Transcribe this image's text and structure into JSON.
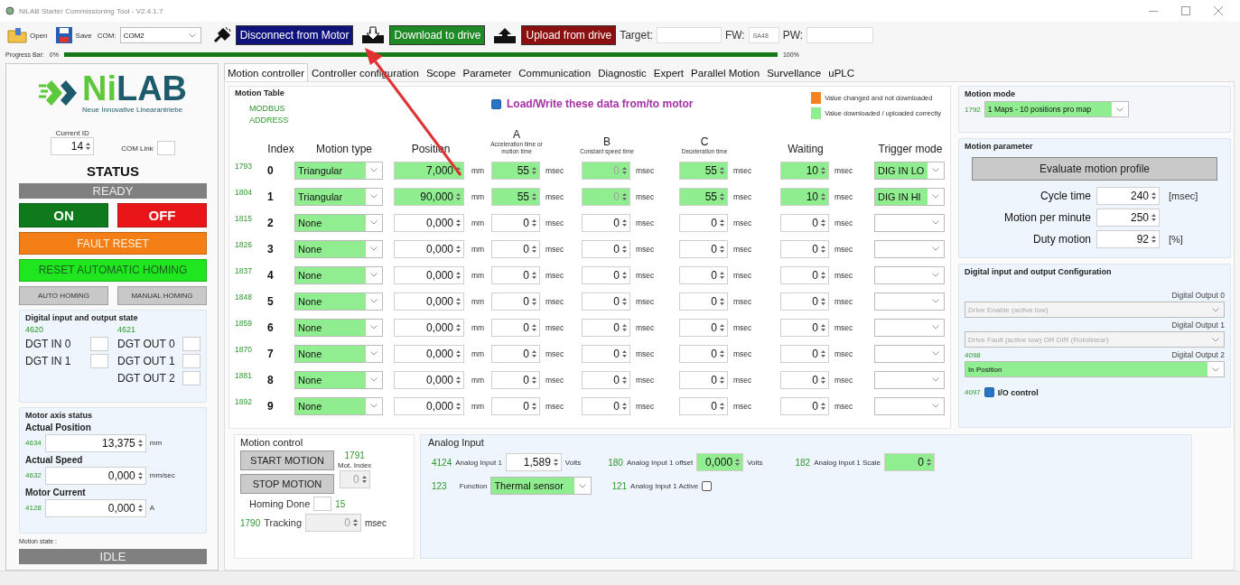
{
  "window": {
    "title": "NiLAB Starter Commissioning Tool - V2.4.1.7"
  },
  "toolbar": {
    "open": "Open",
    "save": "Save",
    "com_label": "COM:",
    "com_value": "COM2",
    "disconnect": "Disconnect from Motor",
    "download": "Download to drive",
    "upload": "Upload from drive",
    "target_label": "Target:",
    "fw_label": "FW:",
    "fw_value": "SA48",
    "pw_label": "PW:"
  },
  "progress": {
    "label": "Progress Bar:",
    "start": "0%",
    "end": "100%",
    "level": 1
  },
  "left": {
    "logo": {
      "name": "NiLAB",
      "tagline": "Neue Innovative Linearantriebe"
    },
    "current_id_label": "Current ID",
    "current_id": "14",
    "com_link_label": "COM Link",
    "com_link_on": false,
    "status_title": "STATUS",
    "status": "READY",
    "on": "ON",
    "off": "OFF",
    "fault_reset": "FAULT RESET",
    "reset_homing": "RESET AUTOMATIC HOMING",
    "auto_homing": "AUTO HOMING",
    "manual_homing": "MANUAL HOMING",
    "dio": {
      "title": "Digital input and output state",
      "inputs_address": "4620",
      "outputs_address": "4621",
      "inputs": [
        {
          "label": "DGT IN 0",
          "on": false
        },
        {
          "label": "DGT IN 1",
          "on": false
        }
      ],
      "outputs": [
        {
          "label": "DGT OUT 0",
          "on": false
        },
        {
          "label": "DGT OUT 1",
          "on": false
        },
        {
          "label": "DGT OUT 2",
          "on": false
        }
      ]
    },
    "axis": {
      "title": "Motor axis status",
      "items": [
        {
          "label": "Actual Position",
          "address": "4634",
          "value": "13,375",
          "unit": "mm"
        },
        {
          "label": "Actual Speed",
          "address": "4632",
          "value": "0,000",
          "unit": "mm/sec"
        },
        {
          "label": "Motor Current",
          "address": "4128",
          "value": "0,000",
          "unit": "A"
        }
      ]
    },
    "motion_state_label": "Motion state :",
    "motion_state": "IDLE"
  },
  "tabs": [
    {
      "label": "Motion controller",
      "selected": true
    },
    {
      "label": "Controller configuration",
      "selected": false
    },
    {
      "label": "Scope",
      "selected": false
    },
    {
      "label": "Parameter",
      "selected": false
    },
    {
      "label": "Communication",
      "selected": false
    },
    {
      "label": "Diagnostic",
      "selected": false
    },
    {
      "label": "Expert",
      "selected": false
    },
    {
      "label": "Parallel Motion",
      "selected": false
    },
    {
      "label": "Survellance",
      "selected": false
    },
    {
      "label": "uPLC",
      "selected": false
    }
  ],
  "motion_table": {
    "title": "Motion Table",
    "modbus_label": "MODBUS ADDRESS",
    "load_write": {
      "label": "Load/Write these data from/to motor",
      "checked": true
    },
    "legend": [
      {
        "label": "Value changed and not downloaded",
        "color": "#f58220"
      },
      {
        "label": "Value downloaded / uploaded correctly",
        "color": "#90ee90"
      }
    ],
    "columns": [
      {
        "label": "Index"
      },
      {
        "label": "Motion type"
      },
      {
        "label": "Position"
      },
      {
        "letter": "A",
        "label": "Acceleration time or motion time"
      },
      {
        "letter": "B",
        "label": "Constant speed time"
      },
      {
        "letter": "C",
        "label": "Deceleration time"
      },
      {
        "label": "Waiting"
      },
      {
        "label": "Trigger mode"
      }
    ],
    "rows": [
      {
        "address": "1793",
        "index": "0",
        "motion_type": "Triangular",
        "synced": true,
        "trigger": "DIG IN LO",
        "values": [
          {
            "value": "7,000",
            "unit": "mm",
            "disabled": false
          },
          {
            "value": "55",
            "unit": "msec",
            "disabled": false
          },
          {
            "value": "0",
            "unit": "msec",
            "disabled": true
          },
          {
            "value": "55",
            "unit": "msec",
            "disabled": false
          },
          {
            "value": "10",
            "unit": "msec",
            "disabled": false
          }
        ]
      },
      {
        "address": "1804",
        "index": "1",
        "motion_type": "Triangular",
        "synced": true,
        "trigger": "DIG IN HI",
        "values": [
          {
            "value": "90,000",
            "unit": "mm",
            "disabled": false
          },
          {
            "value": "55",
            "unit": "msec",
            "disabled": false
          },
          {
            "value": "0",
            "unit": "msec",
            "disabled": true
          },
          {
            "value": "55",
            "unit": "msec",
            "disabled": false
          },
          {
            "value": "10",
            "unit": "msec",
            "disabled": false
          }
        ]
      },
      {
        "address": "1815",
        "index": "2",
        "motion_type": "None",
        "synced": false,
        "values": [
          {
            "value": "0,000",
            "unit": "mm",
            "disabled": false
          },
          {
            "value": "0",
            "unit": "msec",
            "disabled": false
          },
          {
            "value": "0",
            "unit": "msec",
            "disabled": false
          },
          {
            "value": "0",
            "unit": "msec",
            "disabled": false
          },
          {
            "value": "0",
            "unit": "msec",
            "disabled": false
          }
        ]
      },
      {
        "address": "1826",
        "index": "3",
        "motion_type": "None",
        "synced": false,
        "values": [
          {
            "value": "0,000",
            "unit": "mm",
            "disabled": false
          },
          {
            "value": "0",
            "unit": "msec",
            "disabled": false
          },
          {
            "value": "0",
            "unit": "msec",
            "disabled": false
          },
          {
            "value": "0",
            "unit": "msec",
            "disabled": false
          },
          {
            "value": "0",
            "unit": "msec",
            "disabled": false
          }
        ]
      },
      {
        "address": "1837",
        "index": "4",
        "motion_type": "None",
        "synced": false,
        "values": [
          {
            "value": "0,000",
            "unit": "mm",
            "disabled": false
          },
          {
            "value": "0",
            "unit": "msec",
            "disabled": false
          },
          {
            "value": "0",
            "unit": "msec",
            "disabled": false
          },
          {
            "value": "0",
            "unit": "msec",
            "disabled": false
          },
          {
            "value": "0",
            "unit": "msec",
            "disabled": false
          }
        ]
      },
      {
        "address": "1848",
        "index": "5",
        "motion_type": "None",
        "synced": false,
        "values": [
          {
            "value": "0,000",
            "unit": "mm",
            "disabled": false
          },
          {
            "value": "0",
            "unit": "msec",
            "disabled": false
          },
          {
            "value": "0",
            "unit": "msec",
            "disabled": false
          },
          {
            "value": "0",
            "unit": "msec",
            "disabled": false
          },
          {
            "value": "0",
            "unit": "msec",
            "disabled": false
          }
        ]
      },
      {
        "address": "1859",
        "index": "6",
        "motion_type": "None",
        "synced": false,
        "values": [
          {
            "value": "0,000",
            "unit": "mm",
            "disabled": false
          },
          {
            "value": "0",
            "unit": "msec",
            "disabled": false
          },
          {
            "value": "0",
            "unit": "msec",
            "disabled": false
          },
          {
            "value": "0",
            "unit": "msec",
            "disabled": false
          },
          {
            "value": "0",
            "unit": "msec",
            "disabled": false
          }
        ]
      },
      {
        "address": "1870",
        "index": "7",
        "motion_type": "None",
        "synced": false,
        "values": [
          {
            "value": "0,000",
            "unit": "mm",
            "disabled": false
          },
          {
            "value": "0",
            "unit": "msec",
            "disabled": false
          },
          {
            "value": "0",
            "unit": "msec",
            "disabled": false
          },
          {
            "value": "0",
            "unit": "msec",
            "disabled": false
          },
          {
            "value": "0",
            "unit": "msec",
            "disabled": false
          }
        ]
      },
      {
        "address": "1881",
        "index": "8",
        "motion_type": "None",
        "synced": false,
        "values": [
          {
            "value": "0,000",
            "unit": "mm",
            "disabled": false
          },
          {
            "value": "0",
            "unit": "msec",
            "disabled": false
          },
          {
            "value": "0",
            "unit": "msec",
            "disabled": false
          },
          {
            "value": "0",
            "unit": "msec",
            "disabled": false
          },
          {
            "value": "0",
            "unit": "msec",
            "disabled": false
          }
        ]
      },
      {
        "address": "1892",
        "index": "9",
        "motion_type": "None",
        "synced": false,
        "values": [
          {
            "value": "0,000",
            "unit": "mm",
            "disabled": false
          },
          {
            "value": "0",
            "unit": "msec",
            "disabled": false
          },
          {
            "value": "0",
            "unit": "msec",
            "disabled": false
          },
          {
            "value": "0",
            "unit": "msec",
            "disabled": false
          },
          {
            "value": "0",
            "unit": "msec",
            "disabled": false
          }
        ]
      }
    ]
  },
  "right": {
    "motion_mode": {
      "title": "Motion mode",
      "address": "1792",
      "value": "1 Maps - 10 positions pro map"
    },
    "motion_parameter": {
      "title": "Motion parameter",
      "evaluate": "Evaluate motion profile",
      "items": [
        {
          "label": "Cycle time",
          "value": "240",
          "unit": "[msec]"
        },
        {
          "label": "Motion per minute",
          "value": "250"
        },
        {
          "label": "Duty motion",
          "value": "92",
          "unit": "[%]"
        }
      ]
    },
    "dio_config": {
      "title": "Digital input and output Configuration",
      "outputs": [
        {
          "label": "Digital Output 0",
          "value": "Drive Enable (active low)",
          "disabled": true
        },
        {
          "label": "Digital Output 1",
          "value": "Drive Fault (active low) OR DIR (Rotolinear)",
          "disabled": true
        },
        {
          "address": "4098",
          "label": "Digital Output 2",
          "value": "In Position",
          "disabled": false
        }
      ],
      "io_control": {
        "address": "4097",
        "label": "I/O control",
        "checked": true
      }
    }
  },
  "motion_control": {
    "title": "Motion control",
    "start": "START MOTION",
    "stop": "STOP MOTION",
    "index_address": "1791",
    "index_label": "Mot. Index",
    "index_value": "0",
    "homing_label": "Homing Done",
    "homing_done": false,
    "homing_value": "15",
    "tracking_address": "1790",
    "tracking_label": "Tracking",
    "tracking_value": "0",
    "tracking_unit": "msec"
  },
  "analog": {
    "title": "Analog Input",
    "input": {
      "address": "4124",
      "label": "Analog Input 1",
      "value": "1,589",
      "unit": "Volts"
    },
    "offset": {
      "address": "180",
      "label": "Analog Input 1 offset",
      "value": "0,000",
      "unit": "Volts"
    },
    "scale": {
      "address": "182",
      "label": "Analog Input 1 Scale",
      "value": "0"
    },
    "function": {
      "address": "123",
      "label": "Function",
      "value": "Thermal sensor"
    },
    "active": {
      "address": "121",
      "label": "Analog Input 1 Active",
      "checked": false
    }
  }
}
